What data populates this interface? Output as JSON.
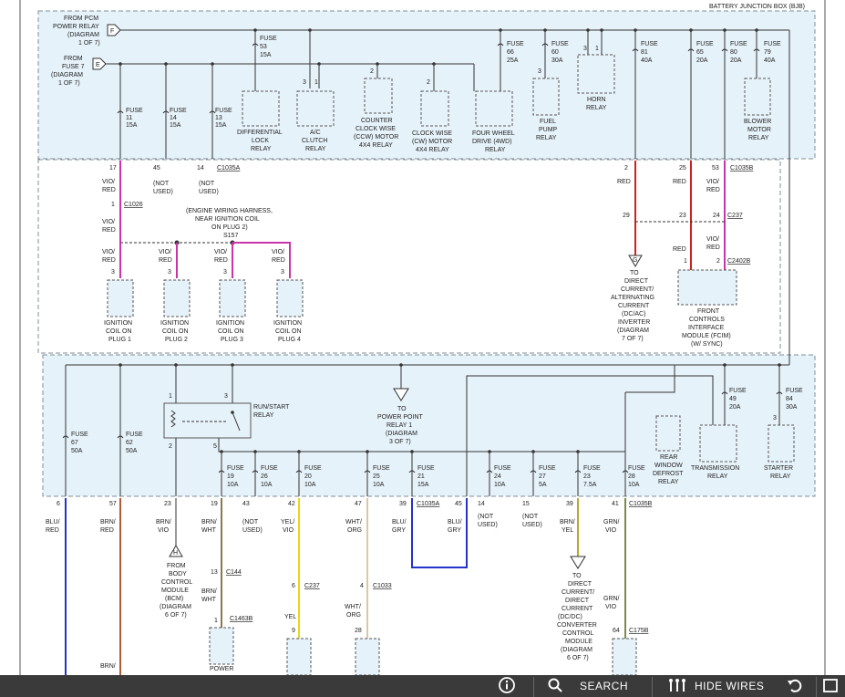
{
  "header": {
    "bjb_label": "BATTERY JUNCTION BOX (BJB)"
  },
  "sources": [
    {
      "id": "F",
      "lines": [
        "FROM PCM",
        "POWER RELAY",
        "(DIAGRAM",
        "1 OF 7)"
      ]
    },
    {
      "id": "E",
      "lines": [
        "FROM",
        "FUSE 7",
        "(DIAGRAM",
        "1 OF 7)"
      ]
    }
  ],
  "fuses": [
    {
      "name": "FUSE",
      "num": "11",
      "amp": "15A"
    },
    {
      "name": "FUSE",
      "num": "14",
      "amp": "15A"
    },
    {
      "name": "FUSE",
      "num": "13",
      "amp": "15A"
    },
    {
      "name": "FUSE",
      "num": "53",
      "amp": "15A"
    },
    {
      "name": "FUSE",
      "num": "66",
      "amp": "25A"
    },
    {
      "name": "FUSE",
      "num": "60",
      "amp": "30A"
    },
    {
      "name": "FUSE",
      "num": "81",
      "amp": "40A"
    },
    {
      "name": "FUSE",
      "num": "65",
      "amp": "20A"
    },
    {
      "name": "FUSE",
      "num": "80",
      "amp": "20A"
    },
    {
      "name": "FUSE",
      "num": "79",
      "amp": "40A"
    },
    {
      "name": "FUSE",
      "num": "67",
      "amp": "50A"
    },
    {
      "name": "FUSE",
      "num": "62",
      "amp": "50A"
    },
    {
      "name": "FUSE",
      "num": "19",
      "amp": "10A"
    },
    {
      "name": "FUSE",
      "num": "26",
      "amp": "10A"
    },
    {
      "name": "FUSE",
      "num": "20",
      "amp": "10A"
    },
    {
      "name": "FUSE",
      "num": "25",
      "amp": "10A"
    },
    {
      "name": "FUSE",
      "num": "21",
      "amp": "15A"
    },
    {
      "name": "FUSE",
      "num": "24",
      "amp": "10A"
    },
    {
      "name": "FUSE",
      "num": "27",
      "amp": "5A"
    },
    {
      "name": "FUSE",
      "num": "23",
      "amp": "7.5A"
    },
    {
      "name": "FUSE",
      "num": "28",
      "amp": "10A"
    },
    {
      "name": "FUSE",
      "num": "49",
      "amp": "20A"
    },
    {
      "name": "FUSE",
      "num": "84",
      "amp": "30A"
    }
  ],
  "relays": [
    {
      "lines": [
        "DIFFERENTIAL",
        "LOCK",
        "RELAY"
      ]
    },
    {
      "lines": [
        "A/C",
        "CLUTCH",
        "RELAY"
      ]
    },
    {
      "lines": [
        "COUNTER",
        "CLOCK WISE",
        "(CCW) MOTOR",
        "4X4 RELAY"
      ]
    },
    {
      "lines": [
        "CLOCK WISE",
        "(CW) MOTOR",
        "4X4 RELAY"
      ]
    },
    {
      "lines": [
        "FOUR WHEEL",
        "DRIVE (4WD)",
        "RELAY"
      ]
    },
    {
      "lines": [
        "FUEL",
        "PUMP",
        "RELAY"
      ]
    },
    {
      "lines": [
        "HORN",
        "RELAY"
      ]
    },
    {
      "lines": [
        "BLOWER",
        "MOTOR",
        "RELAY"
      ]
    },
    {
      "lines": [
        "RUN/START",
        "RELAY"
      ]
    },
    {
      "lines": [
        "REAR",
        "WINDOW",
        "DEFROST",
        "RELAY"
      ]
    },
    {
      "lines": [
        "TRANSMISSION",
        "RELAY"
      ]
    },
    {
      "lines": [
        "STARTER",
        "RELAY"
      ]
    }
  ],
  "relay_pins": [
    "3",
    "3",
    "1",
    "2",
    "2",
    "3",
    "3",
    "1",
    "1",
    "3",
    "2",
    "5",
    "3"
  ],
  "connectors": [
    "C1035A",
    "C1035B",
    "C1026",
    "C237",
    "C2402B",
    "C1035A",
    "C1035B",
    "C144",
    "C237",
    "C1033",
    "C1463B",
    "C175B"
  ],
  "coils": [
    {
      "lines": [
        "IGNITION",
        "COIL ON",
        "PLUG 1"
      ]
    },
    {
      "lines": [
        "IGNITION",
        "COIL ON",
        "PLUG 2"
      ]
    },
    {
      "lines": [
        "IGNITION",
        "COIL ON",
        "PLUG 3"
      ]
    },
    {
      "lines": [
        "IGNITION",
        "COIL ON",
        "PLUG 4"
      ]
    }
  ],
  "splice_note": [
    "(ENGINE WIRING HARNESS,",
    "NEAR IGNITION COIL",
    "ON PLUG 2)",
    "S157"
  ],
  "refs": [
    {
      "id": "G",
      "lines": [
        "TO",
        "DIRECT",
        "CURRENT/",
        "ALTERNATING",
        "CURRENT",
        "(DC/AC)",
        "INVERTER",
        "(DIAGRAM",
        "7 OF 7)"
      ]
    },
    {
      "id": "",
      "lines": [
        "TO",
        "POWER POINT",
        "RELAY 1",
        "(DIAGRAM",
        "3 OF 7)"
      ]
    },
    {
      "id": "H",
      "lines": [
        "FROM",
        "BODY",
        "CONTROL",
        "MODULE",
        "(BCM)",
        "(DIAGRAM",
        "6 OF 7)"
      ]
    },
    {
      "id": "",
      "lines": [
        "TO",
        "DIRECT",
        "CURRENT/",
        "DIRECT",
        "CURRENT",
        "(DC/DC)",
        "CONVERTER",
        "CONTROL",
        "MODULE",
        "(DIAGRAM",
        "6 OF 7)"
      ]
    }
  ],
  "fcim": {
    "lines": [
      "FRONT",
      "CONTROLS",
      "INTERFACE",
      "MODULE (FCIM)",
      "(W/ SYNC)"
    ]
  },
  "power_label": "POWER",
  "wire_colors": {
    "vio_red": "#cc33aa",
    "red": "#cc2222",
    "blu_red": "#2233cc",
    "brn_red": "#b05a3a",
    "yel": "#e8d818",
    "brn_wht": "#8a7a4a",
    "wht_org": "#d8c8a8",
    "blu_gry": "#2233cc",
    "brn_yel": "#b8a830",
    "grn_vio": "#7a8a4a",
    "plain": "#555555"
  },
  "toolbar": {
    "info_icon": "info-icon",
    "search_icon": "search-icon",
    "search_label": "SEARCH",
    "hide_wires_icon": "hide-wires-icon",
    "hide_wires_label": "HIDE WIRES",
    "undo_icon": "undo-icon"
  }
}
